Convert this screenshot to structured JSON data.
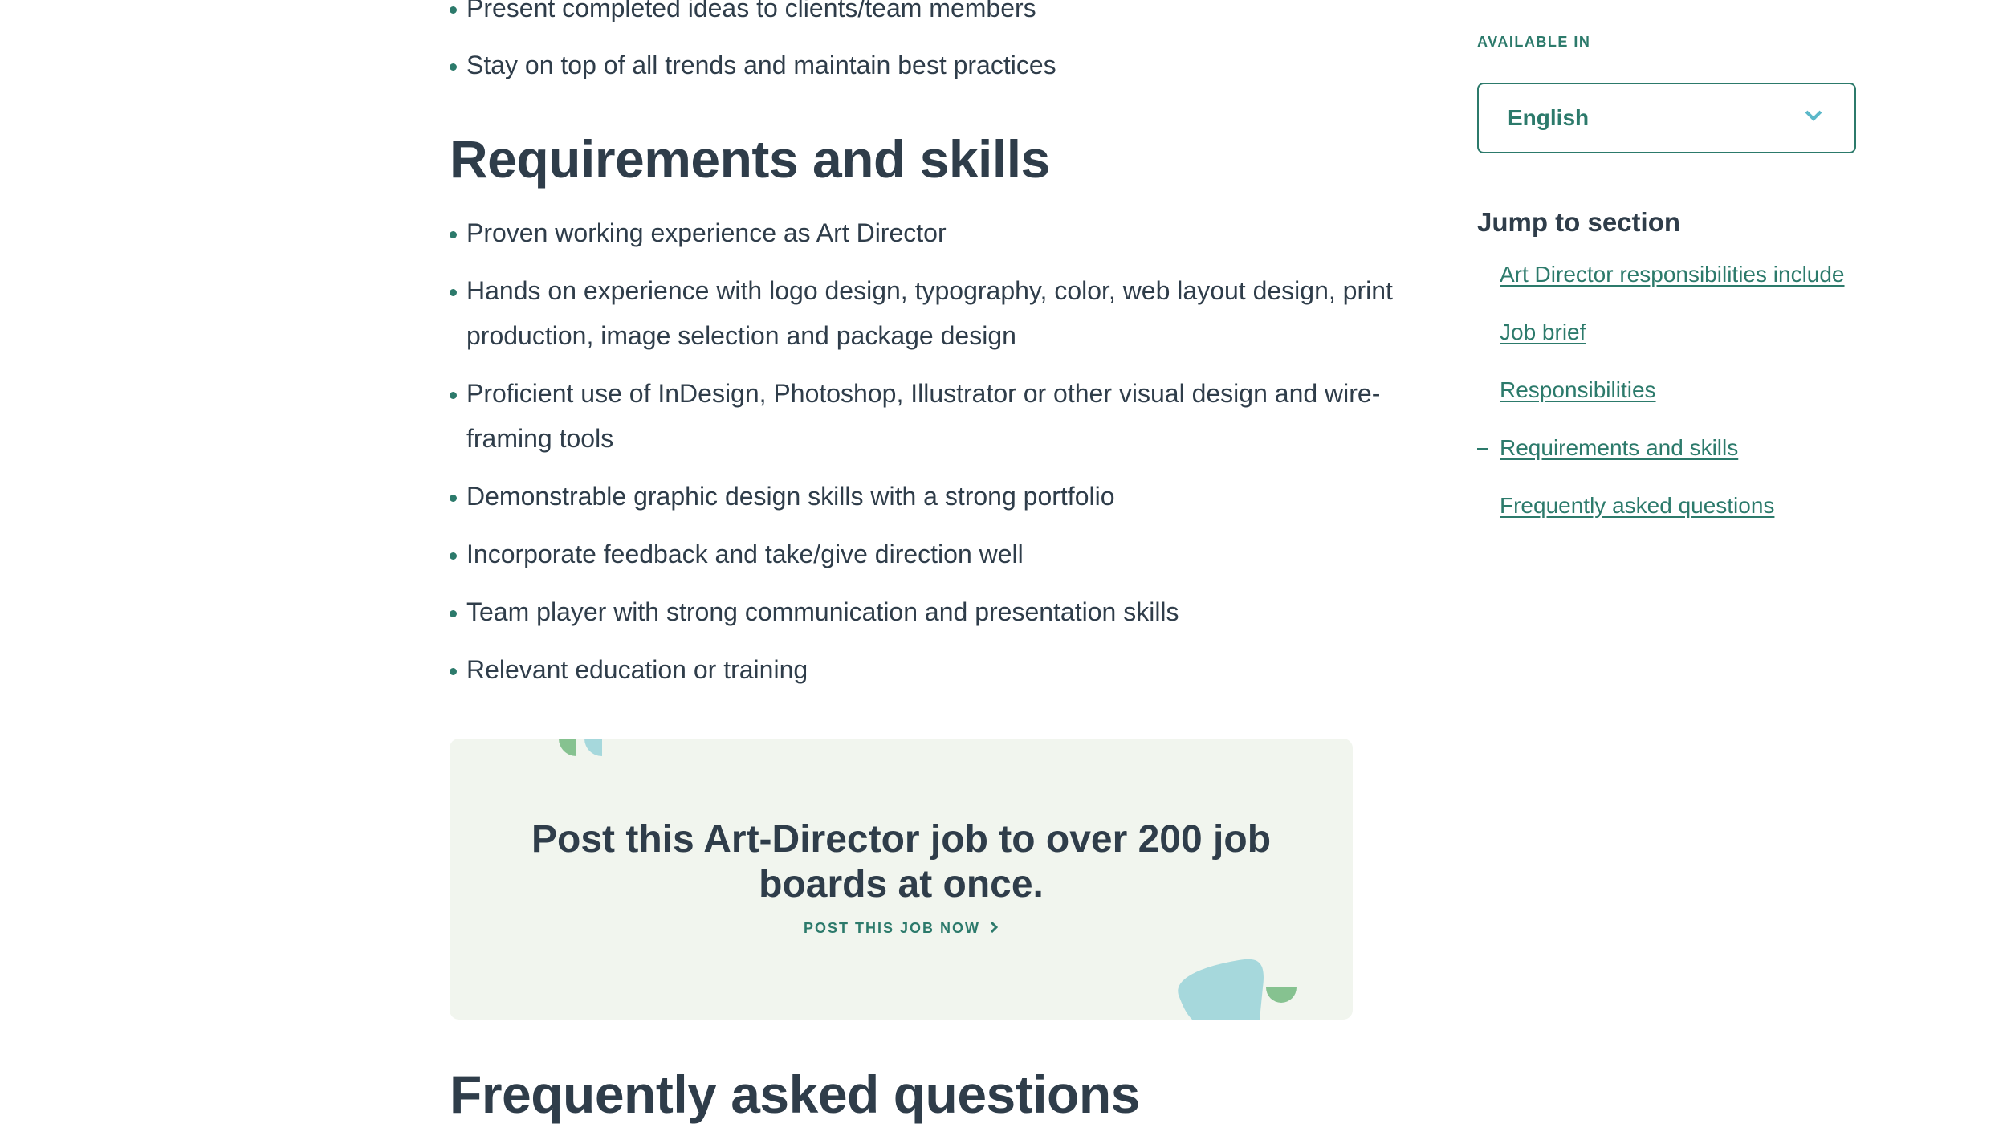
{
  "main": {
    "top_bullets": [
      "Present completed ideas to clients/team members",
      "Stay on top of all trends and maintain best practices"
    ],
    "requirements_heading": "Requirements and skills",
    "requirements": [
      "Proven working experience as Art Director",
      "Hands on experience with logo design, typography, color, web layout design, print production, image selection and package design",
      "Proficient use of InDesign, Photoshop, Illustrator or other visual design and wire-framing tools",
      "Demonstrable graphic design skills with a strong portfolio",
      "Incorporate feedback and take/give direction well",
      "Team player with strong communication and presentation skills",
      "Relevant education or training"
    ],
    "cta": {
      "title": "Post this Art-Director job to over 200 job boards at once.",
      "link_label": "POST THIS JOB NOW",
      "background": "#f1f5ee"
    },
    "faq_heading": "Frequently asked questions"
  },
  "sidebar": {
    "available_in_label": "AVAILABLE IN",
    "language": {
      "selected": "English"
    },
    "jump_title": "Jump to section",
    "toc": [
      {
        "label": "Art Director responsibilities include",
        "active": false
      },
      {
        "label": "Job brief",
        "active": false
      },
      {
        "label": "Responsibilities",
        "active": false
      },
      {
        "label": "Requirements and skills",
        "active": true
      },
      {
        "label": "Frequently asked questions",
        "active": false
      }
    ]
  },
  "colors": {
    "accent": "#2c7a6b",
    "text": "#2f3d4a",
    "chevron": "#5bb8c9",
    "deco_green": "#86c290",
    "deco_teal": "#a6d8dc"
  }
}
